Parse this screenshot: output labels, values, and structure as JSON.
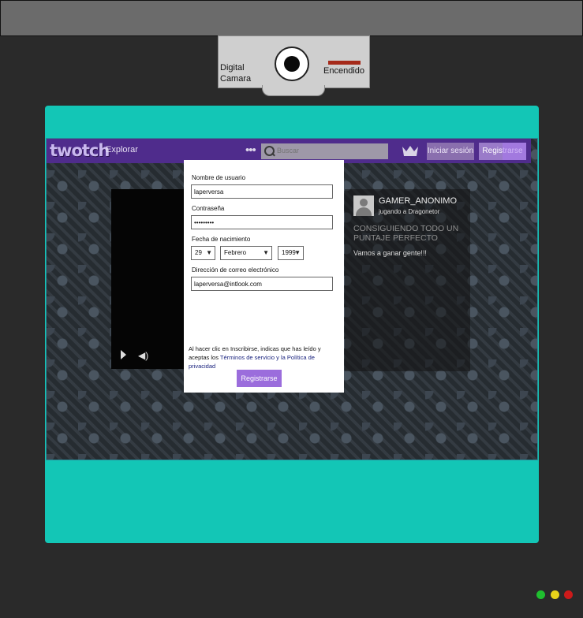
{
  "device": {
    "camera_label": "Digital Camara",
    "camera_status": "Encendido",
    "status_lights": [
      "#1fbf2f",
      "#e8d21a",
      "#cc1a1a"
    ]
  },
  "site": {
    "logo": "twotch",
    "nav_explore": "Explorar",
    "more_icon": "•••",
    "search_placeholder": "Buscar",
    "login_button": "Iniciar sesión",
    "register_button": "Registrarse",
    "accent_color": "#4f2c8c"
  },
  "stream": {
    "streamer_name": "GAMER_ANONIMO",
    "game_line": "jugando a Dragonetor",
    "title": "CONSIGUIENDO TODO UN PUNTAJE PERFECTO",
    "message": "Vamos a ganar gente!!!"
  },
  "signup": {
    "username_label": "Nombre de usuario",
    "username_value": "laperversa",
    "password_label": "Contraseña",
    "password_value": "•••••••••",
    "birthdate_label": "Fecha de nacimiento",
    "day": "29",
    "month": "Febrero",
    "year": "1999",
    "email_label": "Dirección de correo electrónico",
    "email_value": "laperversa@intlook.com",
    "terms_text": "Al hacer clic en Inscribirse, indicas que has leído y aceptas los ",
    "terms_link": "Términos de servicio y la Política de privacidad",
    "submit_button": "Registrarse"
  }
}
